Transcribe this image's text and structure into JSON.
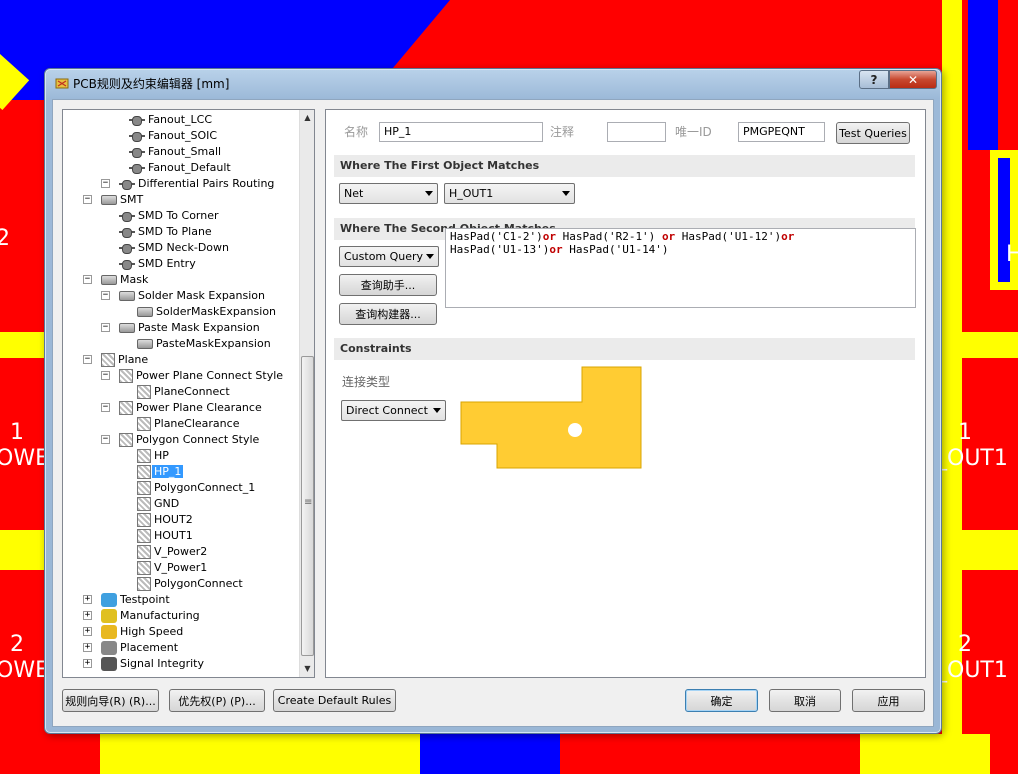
{
  "window": {
    "title": "PCB规则及约束编辑器 [mm]",
    "help_label": "?",
    "close_label": "✕"
  },
  "background": {
    "labels": [
      "2",
      "H",
      "1",
      "OWE",
      "1",
      "_OUT1",
      "2",
      "OWE",
      "2",
      "_OUT1"
    ]
  },
  "tree": {
    "items": [
      {
        "label": "Fanout_LCC"
      },
      {
        "label": "Fanout_SOIC"
      },
      {
        "label": "Fanout_Small"
      },
      {
        "label": "Fanout_Default"
      },
      {
        "label": "Differential Pairs Routing"
      },
      {
        "label": "SMT"
      },
      {
        "label": "SMD To Corner"
      },
      {
        "label": "SMD To Plane"
      },
      {
        "label": "SMD Neck-Down"
      },
      {
        "label": "SMD Entry"
      },
      {
        "label": "Mask"
      },
      {
        "label": "Solder Mask Expansion"
      },
      {
        "label": "SolderMaskExpansion"
      },
      {
        "label": "Paste Mask Expansion"
      },
      {
        "label": "PasteMaskExpansion"
      },
      {
        "label": "Plane"
      },
      {
        "label": "Power Plane Connect Style"
      },
      {
        "label": "PlaneConnect"
      },
      {
        "label": "Power Plane Clearance"
      },
      {
        "label": "PlaneClearance"
      },
      {
        "label": "Polygon Connect Style"
      },
      {
        "label": "HP"
      },
      {
        "label": "HP_1"
      },
      {
        "label": "PolygonConnect_1"
      },
      {
        "label": "GND"
      },
      {
        "label": "HOUT2"
      },
      {
        "label": "HOUT1"
      },
      {
        "label": "V_Power2"
      },
      {
        "label": "V_Power1"
      },
      {
        "label": "PolygonConnect"
      },
      {
        "label": "Testpoint"
      },
      {
        "label": "Manufacturing"
      },
      {
        "label": "High Speed"
      },
      {
        "label": "Placement"
      },
      {
        "label": "Signal Integrity"
      }
    ],
    "selected": "HP_1",
    "scroll_up": "▲",
    "scroll_down": "▼"
  },
  "rule": {
    "name_label": "名称",
    "name_value": "HP_1",
    "comment_label": "注释",
    "comment_value": "",
    "uid_label": "唯一ID",
    "uid_value": "PMGPEQNT",
    "test_queries": "Test Queries"
  },
  "first_match": {
    "header": "Where The First Object Matches",
    "type": "Net",
    "value": "H_OUT1"
  },
  "second_match": {
    "header": "Where The Second Object Matches",
    "type": "Custom Query",
    "helper_button": "查询助手... ",
    "builder_button": "查询构建器... ",
    "query_lines": [
      [
        [
          "HasPad('C1-2')",
          ""
        ],
        [
          "or",
          "kw"
        ],
        [
          " HasPad('R2-1') ",
          ""
        ],
        [
          "or",
          "kw"
        ],
        [
          " HasPad('U1-12')",
          ""
        ],
        [
          "or",
          "kw"
        ]
      ],
      [
        [
          "HasPad('U1-13')",
          ""
        ],
        [
          "or",
          "kw"
        ],
        [
          " HasPad('U1-14')",
          ""
        ]
      ]
    ]
  },
  "constraints": {
    "header": "Constraints",
    "connect_type_label": "连接类型",
    "connect_type_value": "Direct Connect",
    "colors": {
      "fill": "#ffcc33",
      "border": "#d9a400",
      "hole": "#ffffff"
    }
  },
  "buttons": {
    "rule_wizard": "规则向导(R) (R)...",
    "priority": "优先权(P) (P)...",
    "create_default": "Create Default Rules",
    "ok": "确定",
    "cancel": "取消",
    "apply": "应用"
  }
}
